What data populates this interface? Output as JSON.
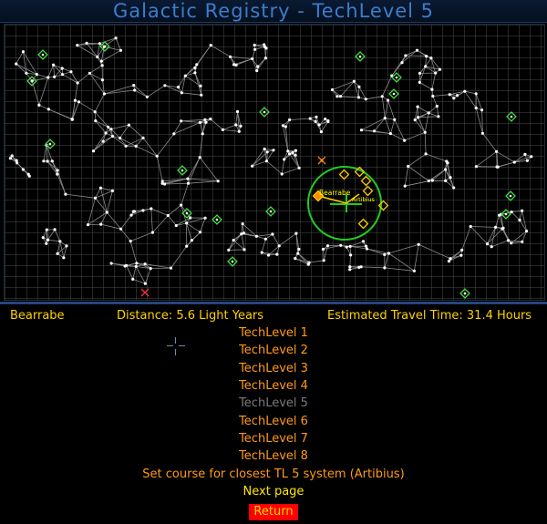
{
  "title": "Galactic Registry - TechLevel 5",
  "info": {
    "system": "Bearrabe",
    "distance": "Distance: 5.6 Light Years",
    "eta": "Estimated Travel Time: 31.4 Hours"
  },
  "map": {
    "selected_label": "Bearrabe",
    "target_label": "Artibius"
  },
  "menu": {
    "items": [
      "TechLevel 1",
      "TechLevel 2",
      "TechLevel 3",
      "TechLevel 4",
      "TechLevel 5",
      "TechLevel 6",
      "TechLevel 7",
      "TechLevel 8"
    ],
    "course": "Set course for closest TL 5 system (Artibius)",
    "next_page": "Next page",
    "return": "Return"
  },
  "colors": {
    "title": "#3c7ccc",
    "info_text": "#ffd200",
    "menu_orange": "#ff9a1a",
    "menu_disabled": "#7a7a7a",
    "next_page": "#ffe600",
    "return_bg": "#ff0000",
    "return_text": "#ffd900",
    "tl_marker": "#44dd44",
    "range_circle": "#22cc22"
  }
}
